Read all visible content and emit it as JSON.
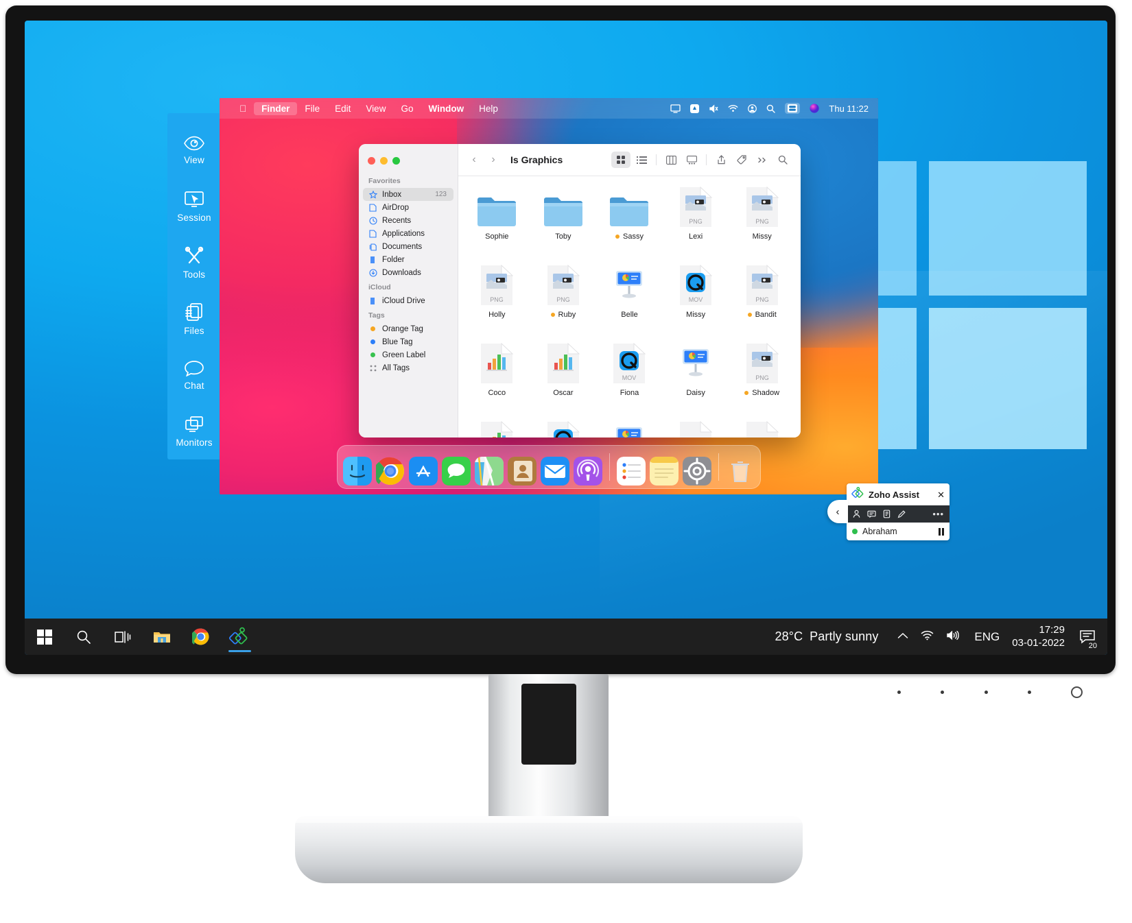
{
  "assist_toolbar": {
    "items": [
      {
        "label": "View",
        "icon": "eye-icon"
      },
      {
        "label": "Session",
        "icon": "monitor-cursor-icon"
      },
      {
        "label": "Tools",
        "icon": "wrench-screwdriver-icon"
      },
      {
        "label": "Files",
        "icon": "file-transfer-icon"
      },
      {
        "label": "Chat",
        "icon": "chat-bubble-icon"
      },
      {
        "label": "Monitors",
        "icon": "multi-monitor-icon"
      }
    ]
  },
  "mac": {
    "menubar": {
      "apple": "apple-icon",
      "items": [
        "Finder",
        "File",
        "Edit",
        "View",
        "Go",
        "Window",
        "Help"
      ],
      "status_icons": [
        "screen-share-icon",
        "control-center-icon",
        "mute-icon",
        "wifi-icon",
        "user-account-icon",
        "search-icon",
        "display-icon",
        "siri-icon"
      ],
      "clock": "Thu 11:22"
    },
    "finder": {
      "title": "Is Graphics",
      "back_label": "‹",
      "forward_label": "›",
      "toolbar_icons": [
        "icon-view-icon",
        "list-view-icon",
        "column-view-icon",
        "gallery-view-icon",
        "share-icon",
        "tag-icon",
        "more-chevrons-icon",
        "search-icon"
      ],
      "sidebar": {
        "sections": [
          {
            "title": "Favorites",
            "rows": [
              {
                "label": "Inbox",
                "icon": "star-icon",
                "count": "123",
                "selected": true
              },
              {
                "label": "AirDrop",
                "icon": "airdrop-icon",
                "count": "",
                "selected": false
              },
              {
                "label": "Recents",
                "icon": "clock-icon",
                "count": "",
                "selected": false
              },
              {
                "label": "Applications",
                "icon": "applications-icon",
                "count": "",
                "selected": false
              },
              {
                "label": "Documents",
                "icon": "documents-icon",
                "count": "",
                "selected": false
              },
              {
                "label": "Folder",
                "icon": "folder-icon",
                "count": "",
                "selected": false
              },
              {
                "label": "Downloads",
                "icon": "downloads-icon",
                "count": "",
                "selected": false
              }
            ]
          },
          {
            "title": "iCloud",
            "rows": [
              {
                "label": "iCloud Drive",
                "icon": "icloud-icon",
                "count": "",
                "selected": false
              }
            ]
          },
          {
            "title": "Tags",
            "rows": [
              {
                "label": "Orange Tag",
                "icon": "orange-dot-icon",
                "count": "",
                "selected": false,
                "color": "#f5a623"
              },
              {
                "label": "Blue Tag",
                "icon": "blue-dot-icon",
                "count": "",
                "selected": false,
                "color": "#2d7ff9"
              },
              {
                "label": "Green Label",
                "icon": "green-dot-icon",
                "count": "",
                "selected": false,
                "color": "#38c14f"
              },
              {
                "label": "All Tags",
                "icon": "all-tags-icon",
                "count": "",
                "selected": false
              }
            ]
          }
        ]
      },
      "files": [
        {
          "name": "Sophie",
          "kind": "folder",
          "badge": "",
          "tag": false
        },
        {
          "name": "Toby",
          "kind": "folder",
          "badge": "",
          "tag": false
        },
        {
          "name": "Sassy",
          "kind": "folder",
          "badge": "",
          "tag": true
        },
        {
          "name": "Lexi",
          "kind": "image",
          "badge": "PNG",
          "tag": false
        },
        {
          "name": "Missy",
          "kind": "image",
          "badge": "PNG",
          "tag": false
        },
        {
          "name": "Holly",
          "kind": "image",
          "badge": "PNG",
          "tag": false
        },
        {
          "name": "Ruby",
          "kind": "image",
          "badge": "PNG",
          "tag": true
        },
        {
          "name": "Belle",
          "kind": "keynote",
          "badge": "",
          "tag": false
        },
        {
          "name": "Missy",
          "kind": "movie",
          "badge": "MOV",
          "tag": false
        },
        {
          "name": "Bandit",
          "kind": "image",
          "badge": "PNG",
          "tag": true
        },
        {
          "name": "Coco",
          "kind": "numbers",
          "badge": "",
          "tag": false
        },
        {
          "name": "Oscar",
          "kind": "numbers",
          "badge": "",
          "tag": false
        },
        {
          "name": "Fiona",
          "kind": "movie",
          "badge": "MOV",
          "tag": false
        },
        {
          "name": "Daisy",
          "kind": "keynote",
          "badge": "",
          "tag": false
        },
        {
          "name": "Shadow",
          "kind": "image",
          "badge": "PNG",
          "tag": true
        },
        {
          "name": "",
          "kind": "numbers",
          "badge": "",
          "tag": false
        },
        {
          "name": "",
          "kind": "movie",
          "badge": "",
          "tag": false
        },
        {
          "name": "",
          "kind": "keynote",
          "badge": "",
          "tag": false
        },
        {
          "name": "",
          "kind": "blank",
          "badge": "",
          "tag": false
        },
        {
          "name": "",
          "kind": "blank",
          "badge": "",
          "tag": false
        }
      ],
      "dock": [
        {
          "name": "Finder",
          "icon": "finder-icon"
        },
        {
          "name": "Google Chrome",
          "icon": "chrome-icon"
        },
        {
          "name": "App Store",
          "icon": "app-store-icon"
        },
        {
          "name": "Messages",
          "icon": "messages-icon"
        },
        {
          "name": "Maps",
          "icon": "maps-icon"
        },
        {
          "name": "Contacts",
          "icon": "contacts-icon"
        },
        {
          "name": "Mail",
          "icon": "mail-icon"
        },
        {
          "name": "Podcasts",
          "icon": "podcasts-icon"
        },
        {
          "name": "Reminders",
          "icon": "reminders-icon"
        },
        {
          "name": "Notes",
          "icon": "notes-icon"
        },
        {
          "name": "System Preferences",
          "icon": "settings-gear-icon"
        },
        {
          "name": "Trash",
          "icon": "trash-icon"
        }
      ]
    }
  },
  "zoho_panel": {
    "title": "Zoho Assist",
    "close_label": "✕",
    "collapse_label": "‹",
    "tool_icons": [
      "participants-icon",
      "chat-icon",
      "clipboard-icon",
      "annotate-pen-icon"
    ],
    "more_label": "•••",
    "user_name": "Abraham",
    "status_color": "#2fbf4f",
    "pause_label": "pause-icon"
  },
  "windows_taskbar": {
    "left_icons": [
      {
        "name": "start-button",
        "icon": "windows-logo-icon"
      },
      {
        "name": "search-button",
        "icon": "search-icon"
      },
      {
        "name": "task-view-button",
        "icon": "task-view-icon"
      },
      {
        "name": "file-explorer-button",
        "icon": "file-explorer-icon"
      },
      {
        "name": "chrome-button",
        "icon": "chrome-icon"
      },
      {
        "name": "zoho-assist-button",
        "icon": "zoho-assist-icon"
      }
    ],
    "weather_temp": "28°C",
    "weather_text": "Partly sunny",
    "tray_icons": [
      "show-hidden-icons-chevron",
      "wifi-icon",
      "volume-icon"
    ],
    "language": "ENG",
    "clock_time": "17:29",
    "clock_date": "03-01-2022",
    "notification_badge": "20"
  },
  "colors": {
    "assist_blue": "#1ea7f0",
    "taskbar": "#1f1f1f",
    "tag_orange": "#f5a623",
    "online_green": "#2fbf4f"
  }
}
